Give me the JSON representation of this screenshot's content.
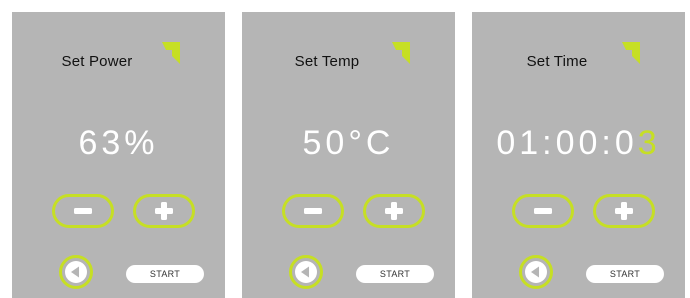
{
  "colors": {
    "accent": "#c6df24",
    "panel_background": "#b5b5b5",
    "readout_text": "#ffffff"
  },
  "icons": {
    "corner": "green-corner-arrow-icon",
    "minus": "minus-icon",
    "plus": "plus-icon",
    "back": "back-arrow-icon"
  },
  "panels": [
    {
      "title": "Set Power",
      "value_main": "63%",
      "value_highlight": "",
      "start_label": "START"
    },
    {
      "title": "Set Temp",
      "value_main": "50°C",
      "value_highlight": "",
      "start_label": "START"
    },
    {
      "title": "Set Time",
      "value_main": "01:00:0",
      "value_highlight": "3",
      "start_label": "START"
    }
  ]
}
